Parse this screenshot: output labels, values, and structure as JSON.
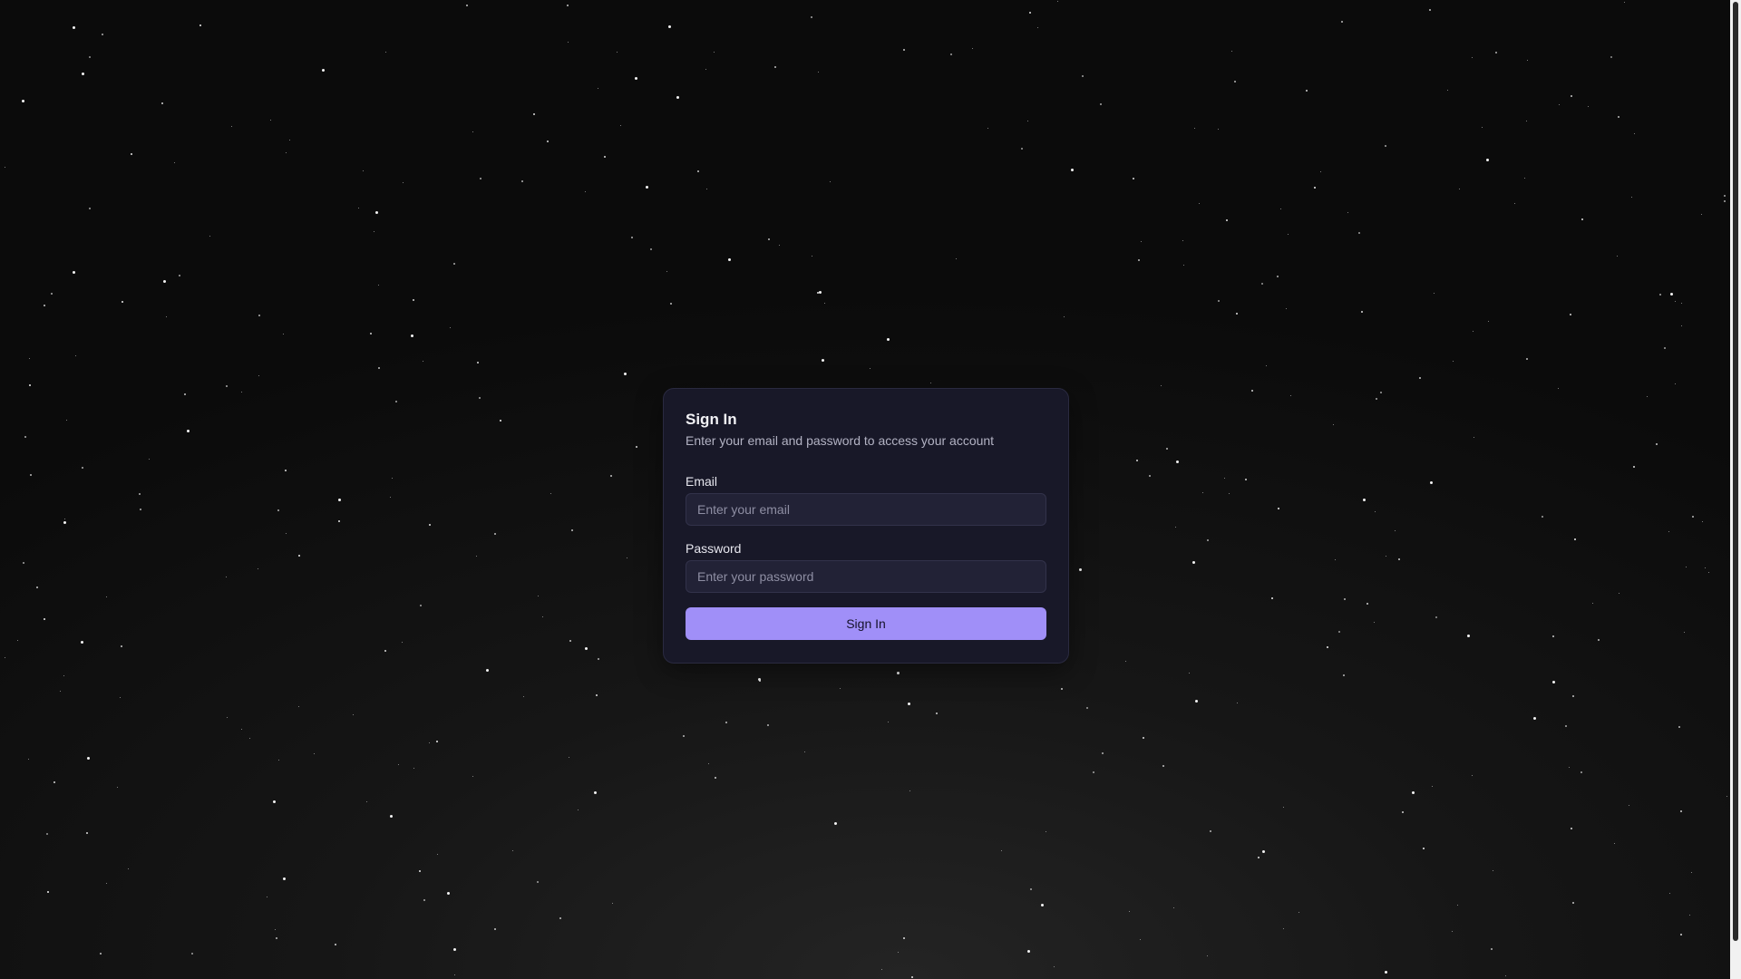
{
  "login": {
    "title": "Sign In",
    "description": "Enter your email and password to access your account",
    "email": {
      "label": "Email",
      "value": "",
      "placeholder": "Enter your email"
    },
    "password": {
      "label": "Password",
      "value": "",
      "placeholder": "Enter your password"
    },
    "submit_label": "Sign In"
  },
  "colors": {
    "accent": "#a08ff8",
    "card_background": "#181828",
    "page_background": "#0b0b0b"
  }
}
